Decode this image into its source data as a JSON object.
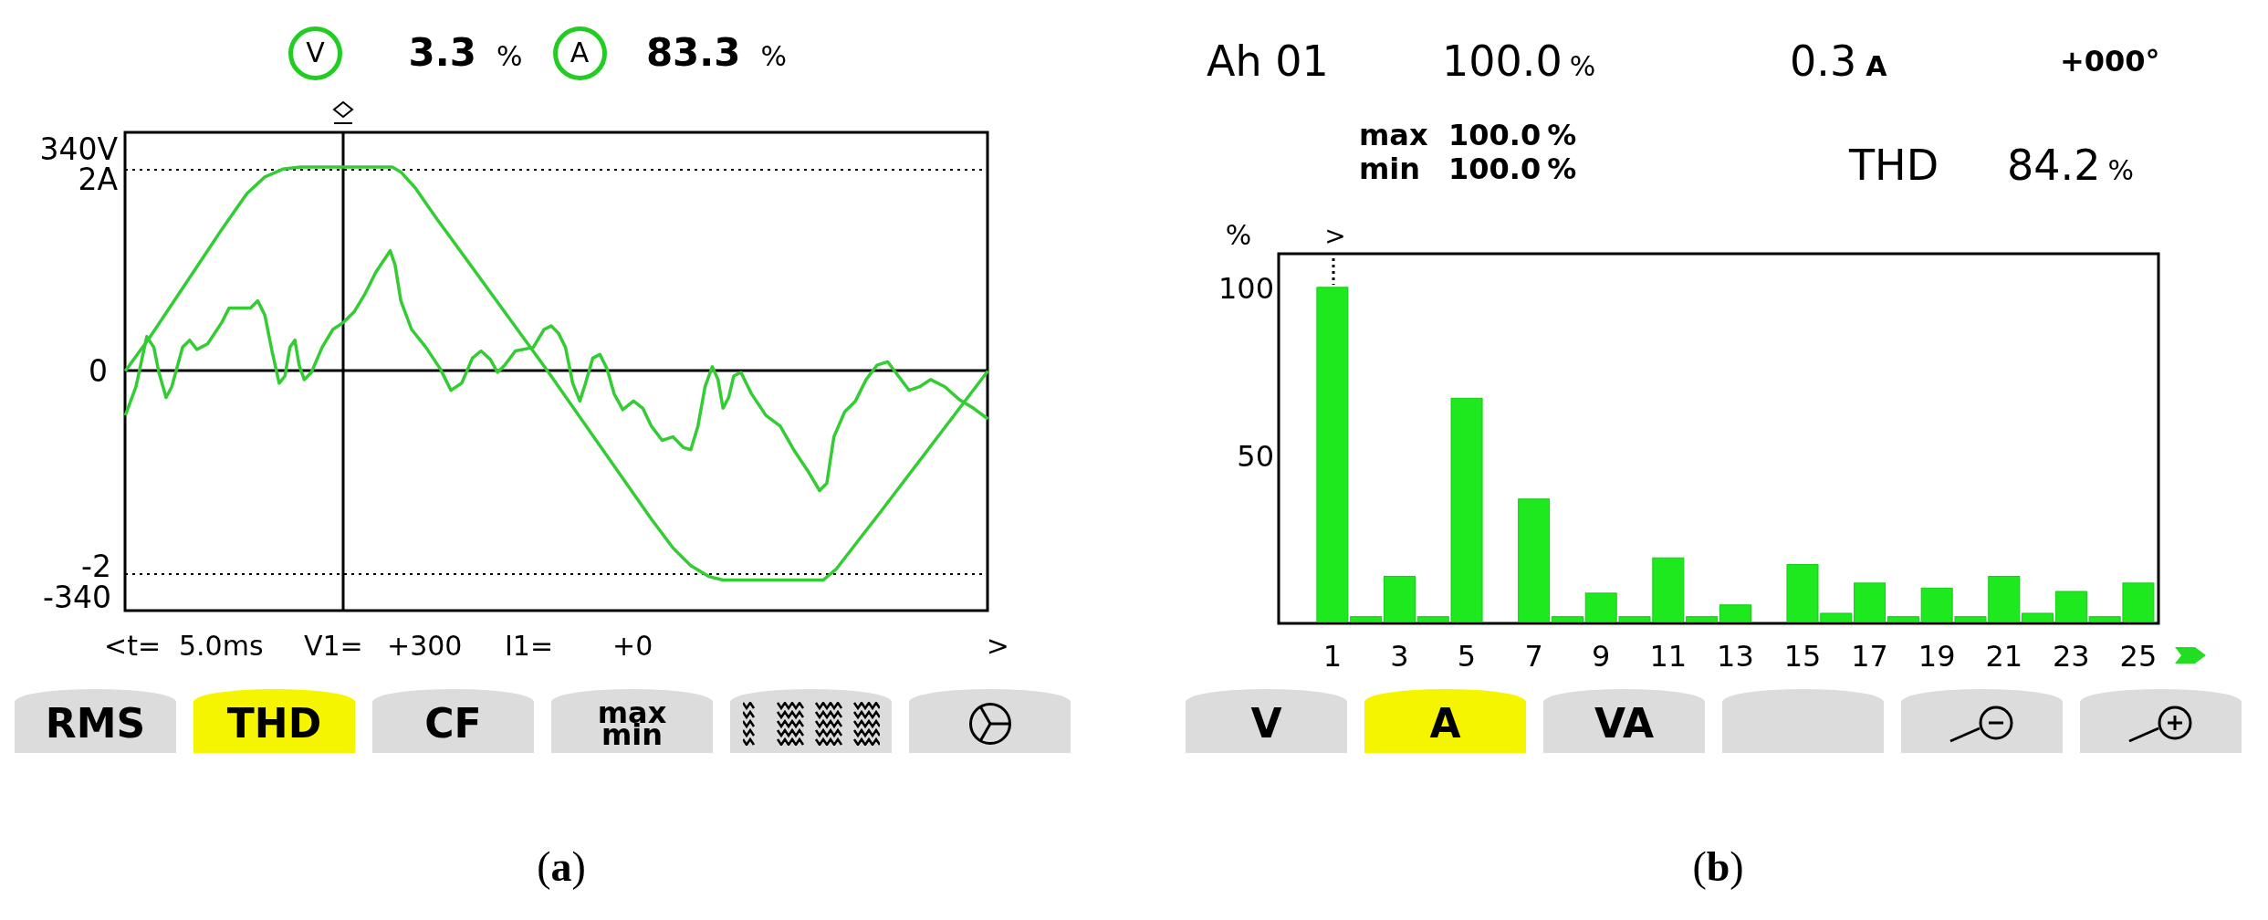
{
  "panel_a": {
    "channels": [
      {
        "symbol": "V",
        "value": "3.3",
        "unit": "%"
      },
      {
        "symbol": "A",
        "value": "83.3",
        "unit": "%"
      }
    ],
    "waveform": {
      "top_labels": [
        "340V",
        "2A"
      ],
      "zero_label": "0",
      "bottom_labels": [
        "-2",
        "-340"
      ]
    },
    "readout": [
      {
        "label": "<t=",
        "value": "5.0ms"
      },
      {
        "label": "V1=",
        "value": "+300"
      },
      {
        "label": "I1=",
        "value": "+0"
      }
    ],
    "next_arrow": ">",
    "softkeys": [
      {
        "kind": "text",
        "label": "RMS",
        "selected": false
      },
      {
        "kind": "text",
        "label": "THD",
        "selected": true
      },
      {
        "kind": "text",
        "label": "CF",
        "selected": false
      },
      {
        "kind": "stacked",
        "lines": [
          "max",
          "min"
        ],
        "selected": false
      },
      {
        "kind": "waves",
        "selected": false
      },
      {
        "kind": "phasor",
        "selected": false
      }
    ],
    "caption": "(**a**)"
  },
  "panel_b": {
    "harmonic": "Ah 01",
    "ratio": {
      "value": "100.0",
      "unit": "%"
    },
    "current": {
      "value": "0.3",
      "unit": "A"
    },
    "phase": "+000°",
    "extremes": [
      {
        "label": "max",
        "value": "100.0",
        "unit": "%"
      },
      {
        "label": "min",
        "value": "100.0",
        "unit": "%"
      }
    ],
    "thd": {
      "label": "THD",
      "value": "84.2",
      "unit": "%"
    },
    "cursor_mark": ">",
    "chart_data": {
      "type": "bar",
      "ylabel": "%",
      "x": [
        1,
        2,
        3,
        4,
        5,
        7,
        8,
        9,
        10,
        11,
        12,
        13,
        15,
        16,
        17,
        18,
        19,
        20,
        21,
        22,
        23,
        24,
        25
      ],
      "values": [
        100,
        2,
        14,
        2,
        67,
        37,
        2,
        9,
        2,
        19.5,
        2,
        5.5,
        17.5,
        3,
        12,
        2,
        10.5,
        2,
        14,
        3,
        9.5,
        2,
        12
      ],
      "xlim": [
        -0.6,
        25.6
      ],
      "ylim": [
        0,
        110
      ],
      "xticks": [
        1,
        3,
        5,
        7,
        9,
        11,
        13,
        15,
        17,
        19,
        21,
        23,
        25
      ],
      "yticks": [
        50,
        100
      ]
    },
    "softkeys": [
      {
        "kind": "text",
        "label": "V",
        "selected": false
      },
      {
        "kind": "text",
        "label": "A",
        "selected": true
      },
      {
        "kind": "text",
        "label": "VA",
        "selected": false
      },
      {
        "kind": "empty",
        "selected": false
      },
      {
        "kind": "zoomout",
        "selected": false
      },
      {
        "kind": "zoomin",
        "selected": false
      }
    ],
    "caption": "(**b**)"
  }
}
